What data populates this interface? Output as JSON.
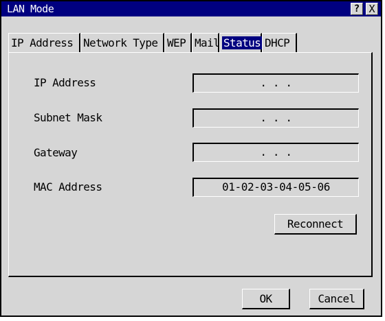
{
  "window": {
    "title": "LAN Mode",
    "help_label": "?",
    "close_label": "X"
  },
  "tabs": [
    {
      "label": "IP Address",
      "active": false
    },
    {
      "label": "Network Type",
      "active": false
    },
    {
      "label": "WEP",
      "active": false
    },
    {
      "label": "Mail",
      "active": false
    },
    {
      "label": "Status",
      "active": true
    },
    {
      "label": "DHCP",
      "active": false
    }
  ],
  "status": {
    "fields": [
      {
        "label": "IP Address",
        "value": ".   .   ."
      },
      {
        "label": "Subnet Mask",
        "value": ".   .   ."
      },
      {
        "label": "Gateway",
        "value": ".   .   ."
      },
      {
        "label": "MAC Address",
        "value": "01-02-03-04-05-06"
      }
    ],
    "reconnect_label": "Reconnect"
  },
  "footer": {
    "ok_label": "OK",
    "cancel_label": "Cancel"
  },
  "colors": {
    "titlebar": "#000080",
    "dialog_bg": "#d6d6d6",
    "active_tab": "#000080"
  }
}
